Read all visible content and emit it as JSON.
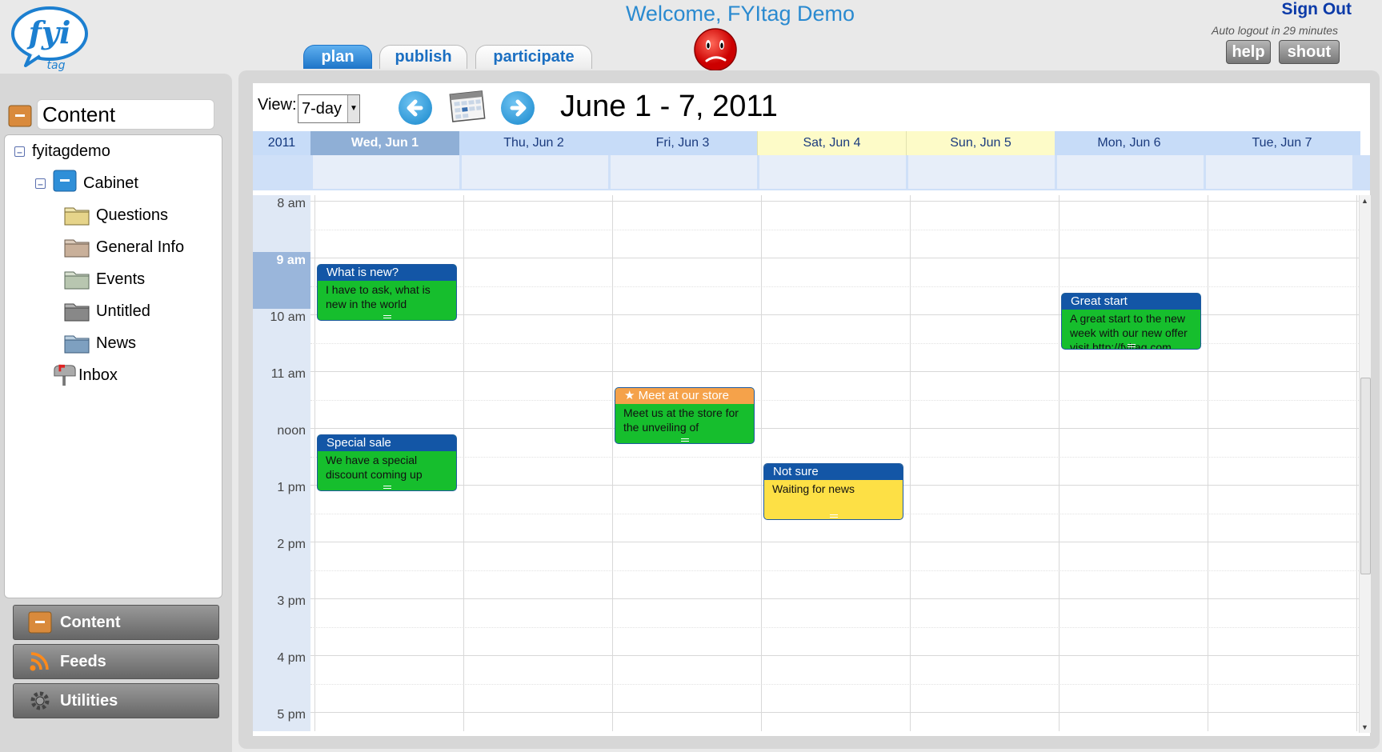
{
  "header": {
    "welcome": "Welcome, FYItag Demo",
    "logo_main": "fyi",
    "logo_sub": "tag",
    "sign_out": "Sign Out",
    "auto_logout": "Auto logout in 29 minutes",
    "help": "help",
    "shout": "shout",
    "status_icon": "sad-face-icon"
  },
  "tabs": [
    {
      "label": "plan",
      "active": true
    },
    {
      "label": "publish",
      "active": false
    },
    {
      "label": "participate",
      "active": false
    }
  ],
  "sidebar": {
    "content_title": "Content",
    "tree": {
      "root": "fyitagdemo",
      "cabinet": "Cabinet",
      "folders": [
        "Questions",
        "General Info",
        "Events",
        "Untitled",
        "News"
      ],
      "inbox": "Inbox"
    },
    "accordion": [
      {
        "label": "Content",
        "icon": "content-icon"
      },
      {
        "label": "Feeds",
        "icon": "rss-icon"
      },
      {
        "label": "Utilities",
        "icon": "gear-icon"
      }
    ]
  },
  "calendar": {
    "view_label": "View:",
    "view_value": "7-day",
    "range": "June 1 - 7, 2011",
    "year": "2011",
    "days": [
      {
        "label": "Wed, Jun 1",
        "type": "today"
      },
      {
        "label": "Thu, Jun 2",
        "type": "weekday"
      },
      {
        "label": "Fri, Jun 3",
        "type": "weekday"
      },
      {
        "label": "Sat, Jun 4",
        "type": "weekend"
      },
      {
        "label": "Sun, Jun 5",
        "type": "weekend"
      },
      {
        "label": "Mon, Jun 6",
        "type": "weekday"
      },
      {
        "label": "Tue, Jun 7",
        "type": "weekday"
      }
    ],
    "hours": [
      "8 am",
      "9 am",
      "10 am",
      "11 am",
      "noon",
      "1 pm",
      "2 pm",
      "3 pm",
      "4 pm",
      "5 pm"
    ],
    "current_hour": "9 am",
    "events": [
      {
        "title": "What is new?",
        "body": "I have to ask, what is new in the world",
        "day": 0,
        "start": 10.0,
        "end": 11.0,
        "body_color": "#16be2d",
        "title_color": "#1356a6"
      },
      {
        "title": "Special sale",
        "body": "We have a special discount coming up",
        "day": 0,
        "start": 13.0,
        "end": 14.0,
        "body_color": "#16be2d",
        "title_color": "#1356a6"
      },
      {
        "title": "★ Meet at our store",
        "body": "Meet us at the store for the unveiling of",
        "day": 2,
        "start": 12.17,
        "end": 13.17,
        "body_color": "#16be2d",
        "title_color": "#f5a24a"
      },
      {
        "title": "Not sure",
        "body": "Waiting for news",
        "day": 3,
        "start": 13.5,
        "end": 14.5,
        "body_color": "#fde045",
        "title_color": "#1356a6"
      },
      {
        "title": "Great start",
        "body": "A great start to the new week with our new offer visit http://fyitag.com",
        "day": 5,
        "start": 10.5,
        "end": 11.5,
        "body_color": "#16be2d",
        "title_color": "#1356a6"
      }
    ]
  },
  "colors": {
    "accent": "#2a8ad0",
    "today_header": "#8fafd6",
    "weekend_header": "#fdfbc8",
    "weekday_header": "#c7dcf8"
  }
}
